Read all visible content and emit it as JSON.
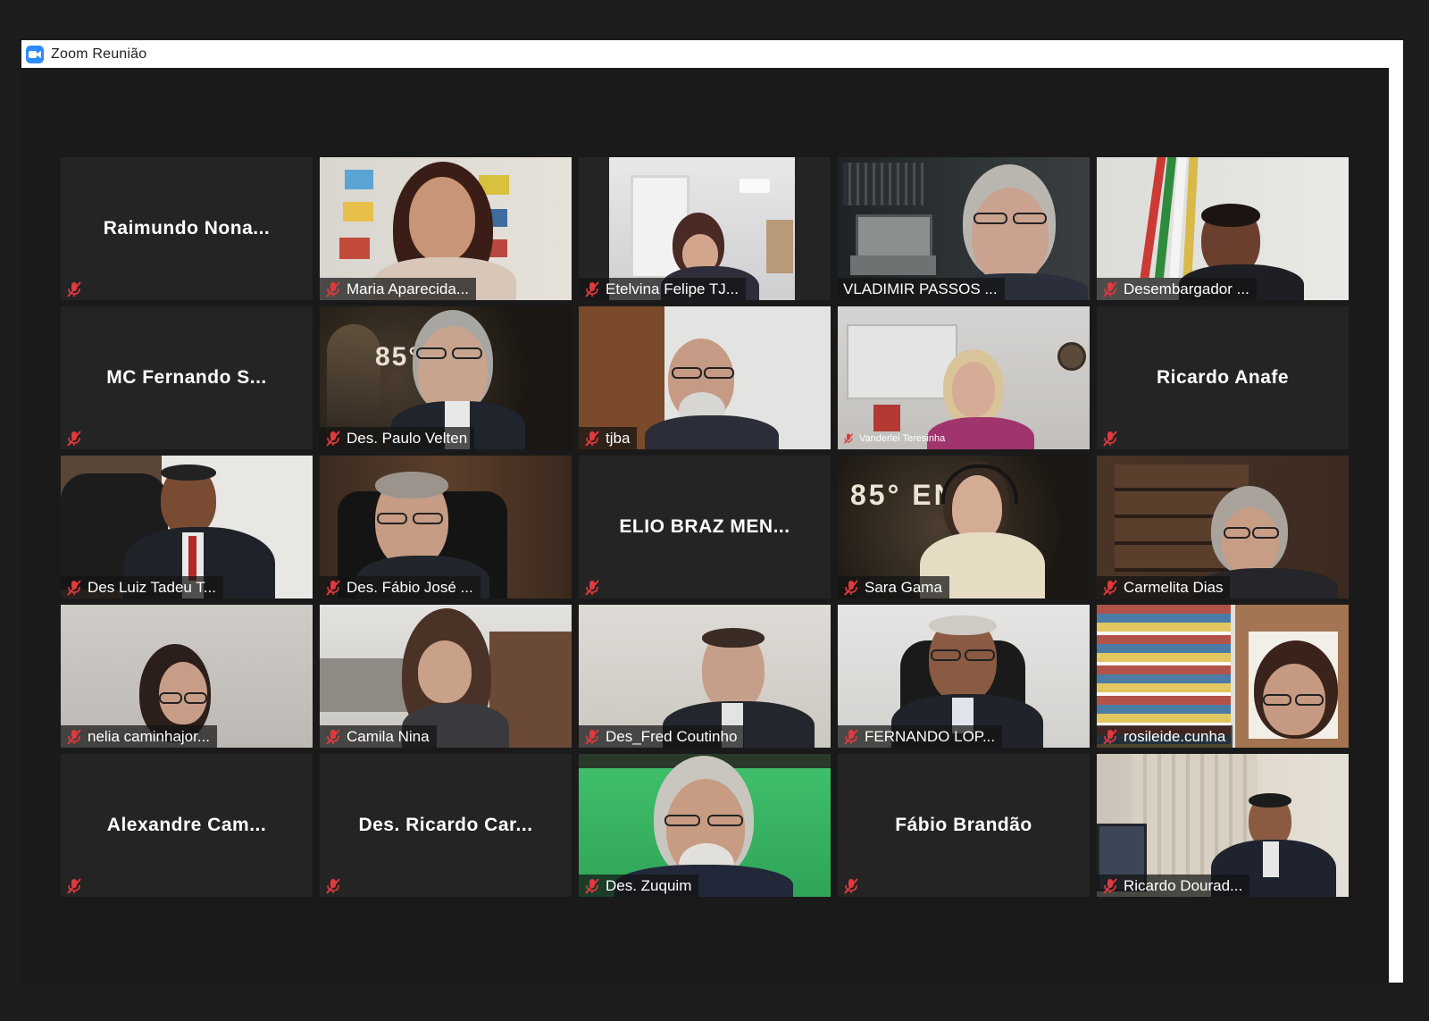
{
  "window": {
    "title": "Zoom Reunião",
    "app_icon": "zoom-camera-icon"
  },
  "colors": {
    "active_speaker": "#e5e84b",
    "muted_icon": "#e0393e",
    "tile_bg": "#242424"
  },
  "participants": [
    {
      "name": "Raimundo  Nona...",
      "video": false,
      "muted": true
    },
    {
      "name": "Maria Aparecida...",
      "video": true,
      "muted": true
    },
    {
      "name": "Etelvina Felipe TJ...",
      "video": true,
      "muted": true
    },
    {
      "name": "VLADIMIR PASSOS ...",
      "video": true,
      "muted": false,
      "active_speaker": true
    },
    {
      "name": "Desembargador ...",
      "video": true,
      "muted": true
    },
    {
      "name": "MC  Fernando  S...",
      "video": false,
      "muted": true
    },
    {
      "name": "Des. Paulo Velten",
      "video": true,
      "muted": true,
      "background_text": "85° DGE"
    },
    {
      "name": "tjba",
      "video": true,
      "muted": true
    },
    {
      "name": "Vanderlei Teresinha",
      "video": true,
      "muted": true
    },
    {
      "name": "Ricardo Anafe",
      "video": false,
      "muted": true
    },
    {
      "name": "Des Luiz Tadeu T...",
      "video": true,
      "muted": true
    },
    {
      "name": "Des. Fábio José ...",
      "video": true,
      "muted": true
    },
    {
      "name": "ELIO BRAZ MEN...",
      "video": false,
      "muted": true
    },
    {
      "name": "Sara Gama",
      "video": true,
      "muted": true,
      "background_text": "85° ENGE"
    },
    {
      "name": "Carmelita Dias",
      "video": true,
      "muted": true
    },
    {
      "name": "nelia caminhajor...",
      "video": true,
      "muted": true
    },
    {
      "name": "Camila Nina",
      "video": true,
      "muted": true
    },
    {
      "name": "Des_Fred Coutinho",
      "video": true,
      "muted": true
    },
    {
      "name": "FERNANDO LOP...",
      "video": true,
      "muted": true
    },
    {
      "name": "rosileide.cunha",
      "video": true,
      "muted": true
    },
    {
      "name": "Alexandre  Cam...",
      "video": false,
      "muted": true
    },
    {
      "name": "Des.  Ricardo Car...",
      "video": false,
      "muted": true
    },
    {
      "name": "Des. Zuquim",
      "video": true,
      "muted": true
    },
    {
      "name": "Fábio Brandão",
      "video": false,
      "muted": true
    },
    {
      "name": "Ricardo Dourad...",
      "video": true,
      "muted": true
    }
  ]
}
